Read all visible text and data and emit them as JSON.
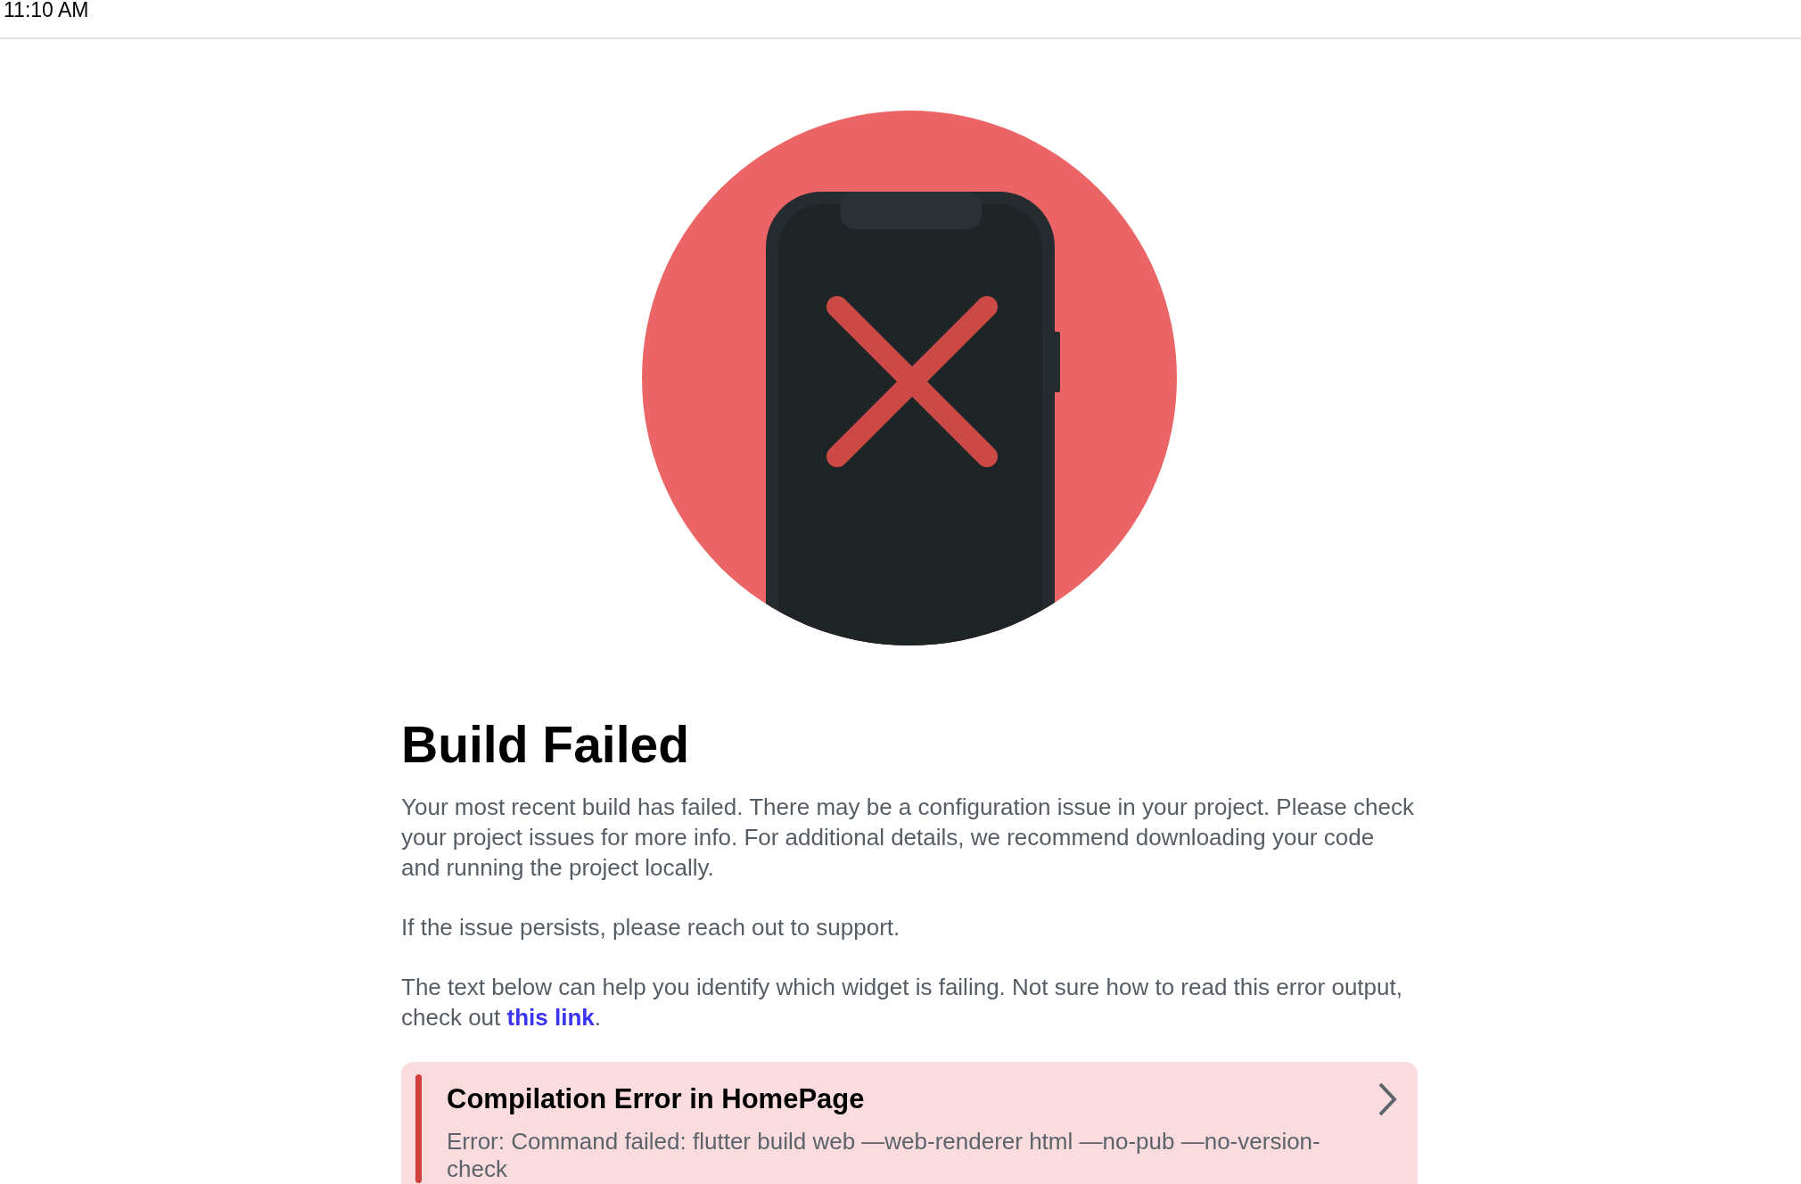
{
  "status_bar": {
    "time": "11:10 AM"
  },
  "title": "Build Failed",
  "paragraphs": [
    {
      "text": "Your most recent build has failed. There may be a configuration issue in your project. Please check your project issues for more info. For additional details, we recommend downloading your code and running the project locally."
    },
    {
      "text": "If the issue persists, please reach out to support."
    },
    {
      "text": "The text below can help you identify which widget is failing. Not sure how to read this error output, check out ",
      "link": "this link",
      "after": "."
    }
  ],
  "error_card": {
    "title": "Compilation Error in HomePage",
    "message": "Error: Command failed: flutter build web  —web-renderer html —no-pub —no-version-check"
  }
}
